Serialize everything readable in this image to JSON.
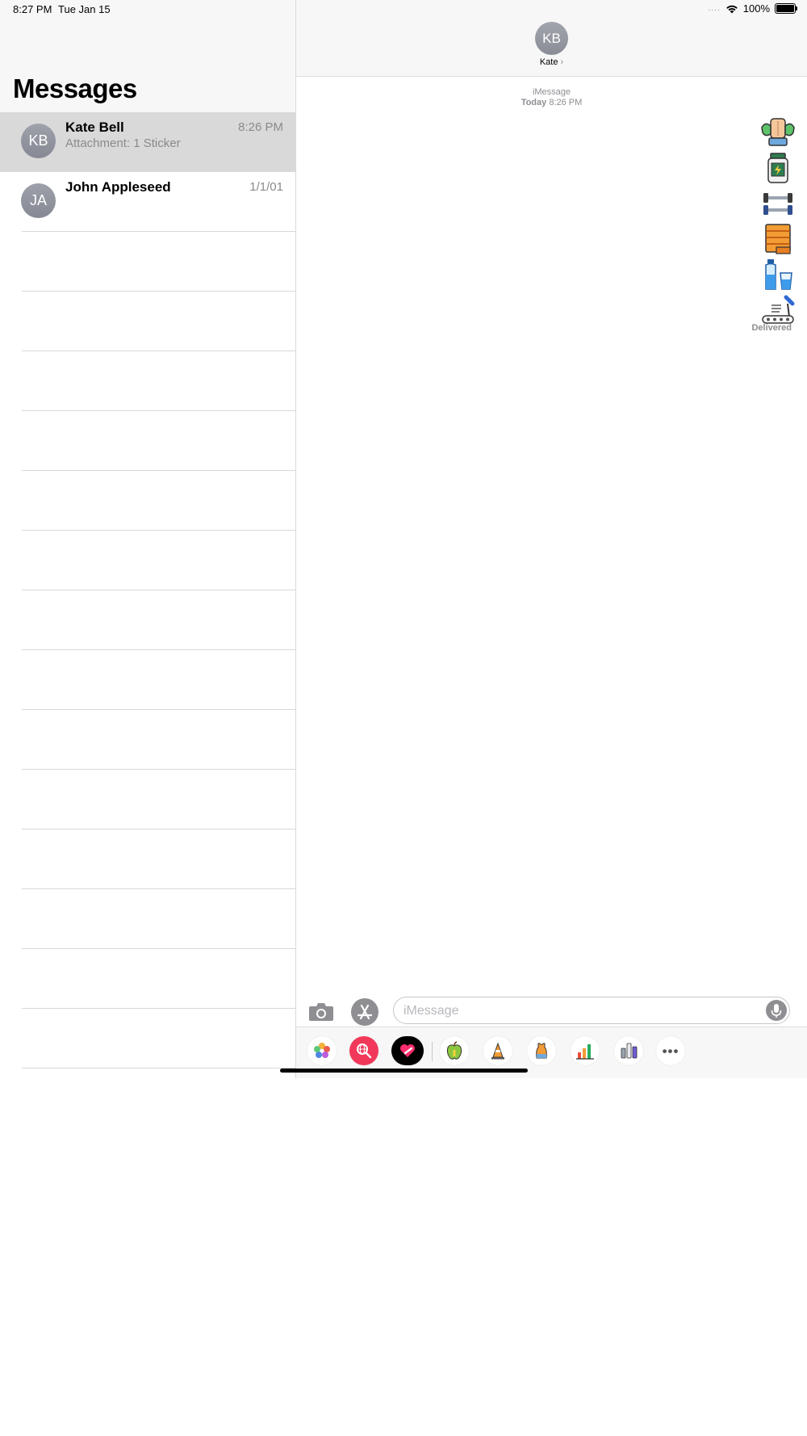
{
  "status_bar": {
    "time": "8:27 PM",
    "date": "Tue Jan 15",
    "signal_dots": "....",
    "battery": "100%"
  },
  "sidebar": {
    "title": "Messages",
    "conversations": [
      {
        "initials": "KB",
        "name": "Kate Bell",
        "preview": "Attachment: 1 Sticker",
        "time": "8:26 PM",
        "selected": true
      },
      {
        "initials": "JA",
        "name": "John Appleseed",
        "preview": "",
        "time": "1/1/01",
        "selected": false
      }
    ]
  },
  "chat": {
    "contact_initials": "KB",
    "contact_name": "Kate",
    "chevron": "›",
    "service": "iMessage",
    "day": "Today",
    "time": "8:26 PM",
    "stickers": [
      "muscle-arms-sticker",
      "supplement-jar-sticker",
      "dumbbell-sticker",
      "measuring-tape-sticker",
      "water-bottle-glass-sticker",
      "treadmill-sticker"
    ],
    "delivered": "Delivered",
    "input_placeholder": "iMessage",
    "app_drawer": [
      "photos-app-icon",
      "search-images-app-icon",
      "digital-touch-app-icon",
      "apple-app-icon",
      "cone-app-icon",
      "tank-top-app-icon",
      "bar-chart-app-icon",
      "bottles-app-icon",
      "more-apps-icon"
    ],
    "more_label": "•••"
  },
  "colors": {
    "selected_row": "#d9d9d9",
    "gray": "#8e8e93",
    "header_bg": "#f7f7f7"
  }
}
